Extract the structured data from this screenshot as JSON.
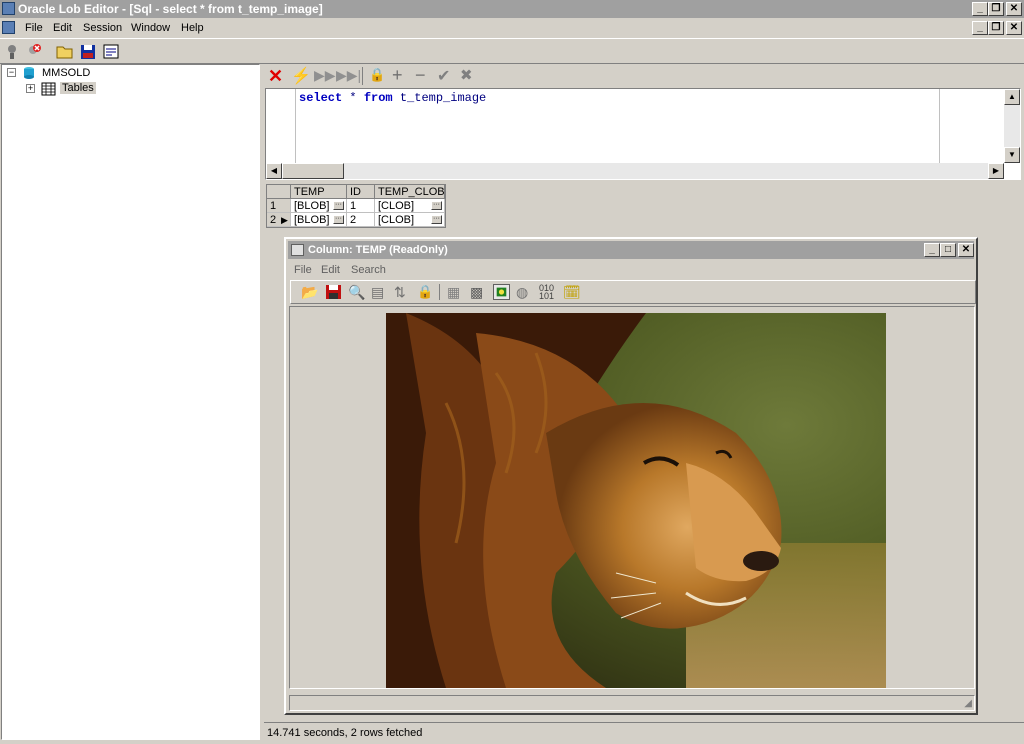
{
  "window": {
    "title": "Oracle Lob Editor - [Sql - select * from t_temp_image]"
  },
  "menubar": {
    "items": [
      "File",
      "Edit",
      "Session",
      "Window",
      "Help"
    ]
  },
  "tree": {
    "root": "MMSOLD",
    "child": "Tables"
  },
  "sql": {
    "text_parts": {
      "k1": "select",
      "star": "*",
      "k2": "from",
      "table": "t_temp_image"
    }
  },
  "grid": {
    "headers": [
      "TEMP",
      "ID",
      "TEMP_CLOB"
    ],
    "rows": [
      {
        "num": "1",
        "temp": "[BLOB]",
        "id": "1",
        "clob": "[CLOB]"
      },
      {
        "num": "2",
        "temp": "[BLOB]",
        "id": "2",
        "clob": "[CLOB]"
      }
    ]
  },
  "child": {
    "title": "Column: TEMP  (ReadOnly)",
    "menu": [
      "File",
      "Edit",
      "Search"
    ]
  },
  "status": {
    "text": "14.741 seconds,  2 rows fetched"
  }
}
